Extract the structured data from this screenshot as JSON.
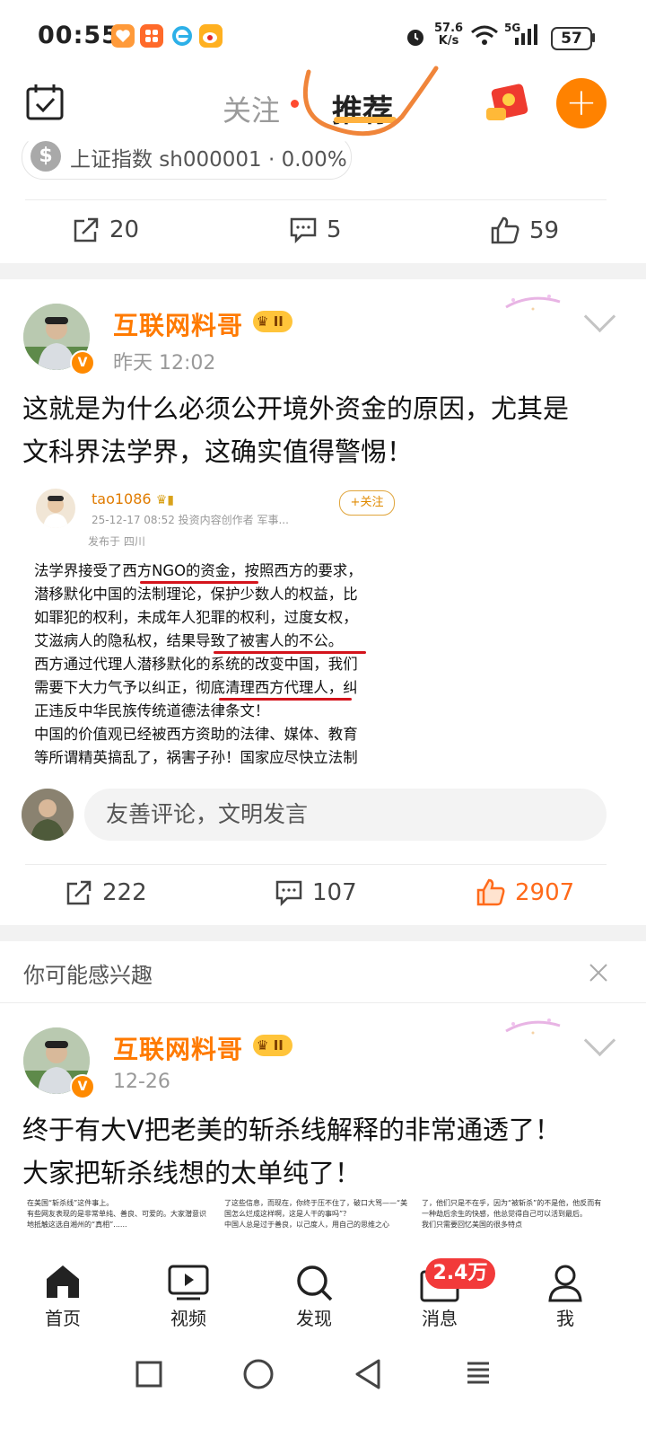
{
  "status_bar": {
    "time": "00:55",
    "net_speed_value": "57.6",
    "net_speed_unit": "K/s",
    "signal_label": "5G",
    "battery": "57"
  },
  "top_nav": {
    "tab_follow": "关注",
    "tab_recommend": "推荐"
  },
  "previous_post": {
    "stock_chip": "上证指数 sh000001 · 0.00%",
    "repost_count": "20",
    "comment_count": "5",
    "like_count": "59"
  },
  "post": {
    "username": "互联网料哥",
    "level_badge": "II",
    "time": "昨天 12:02",
    "text_line1": "这就是为什么必须公开境外资金的原因，尤其是",
    "text_line2": "文科界法学界，这确实值得警惕！",
    "embedded": {
      "username": "tao1086",
      "follow_label": "+关注",
      "meta": "25-12-17 08:52  投资内容创作者 军事...",
      "location": "发布于 四川",
      "lines": [
        "法学界接受了西方NGO的资金，按照西方的要求，",
        "潜移默化中国的法制理论，保护少数人的权益，比",
        "如罪犯的权利，未成年人犯罪的权利，过度女权，",
        "艾滋病人的隐私权，结果导致了被害人的不公。",
        "西方通过代理人潜移默化的系统的改变中国，我们",
        "需要下大力气予以纠正，彻底清理西方代理人，纠",
        "正违反中华民族传统道德法律条文！",
        "中国的价值观已经被西方资助的法律、媒体、教育",
        "等所谓精英搞乱了，祸害子孙！国家应尽快立法制"
      ]
    },
    "comment_placeholder": "友善评论，文明发言",
    "repost_count": "222",
    "comment_count": "107",
    "like_count": "2907"
  },
  "interest_section": {
    "title": "你可能感兴趣"
  },
  "post2": {
    "username": "互联网料哥",
    "level_badge": "II",
    "time": "12-26",
    "text_line1": "终于有大V把老美的斩杀线解释的非常通透了！",
    "text_line2": "大家把斩杀线想的太单纯了！",
    "thumbs": [
      "在美国“斩杀线”这件事上。\n有些网友表现的是非常单纯、善良、可爱的。大家潜意识地抵触这选自湘州的“真相”......",
      "了这些信息，而现在，你终于压不住了，破口大骂——“美国怎么烂成这样啊，这是人干的事吗”？\n中国人总是过于善良，以己度人，用自己的思维之心",
      "了，他们只是不在乎，因为“被斩杀”的不是他，他反而有一种劫后余生的快感，他总觉得自己可以活到最后。\n我们只需要回忆美国的很多特点"
    ]
  },
  "bottom_nav": {
    "home": "首页",
    "video": "视频",
    "discover": "发现",
    "messages": "消息",
    "messages_badge": "2.4万",
    "me": "我"
  },
  "colors": {
    "accent_orange": "#ff8200",
    "username_orange": "#ff7a00",
    "like_active": "#ff6a1a",
    "badge_red": "#f23a3a",
    "underline_red": "#d4141c"
  }
}
